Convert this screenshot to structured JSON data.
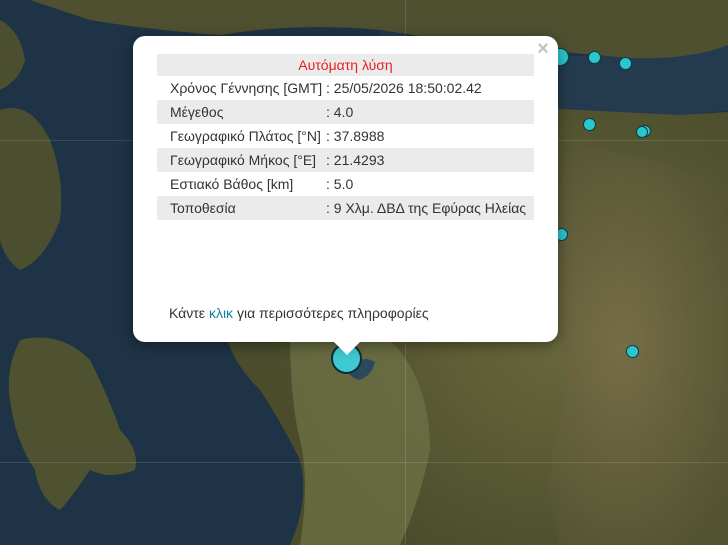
{
  "map": {
    "water_color": "#1e3345",
    "land_color": "#5a5a34",
    "marker_color": "#2cc6d1"
  },
  "popup": {
    "title": "Αυτόματη λύση",
    "title_color": "#e8201e",
    "close_symbol": "×",
    "rows": [
      {
        "label": "Χρόνος Γέννησης [GMT]",
        "value": ": 25/05/2026 18:50:02.42"
      },
      {
        "label": "Μέγεθος",
        "value": ": 4.0"
      },
      {
        "label": "Γεωγραφικό Πλάτος [°N]",
        "value": ": 37.8988"
      },
      {
        "label": "Γεωγραφικό Μήκος [°E]",
        "value": ": 21.4293"
      },
      {
        "label": "Εστιακό Βάθος [km]",
        "value": ": 5.0"
      },
      {
        "label": "Τοποθεσία",
        "value": ": 9 Χλμ. ΔΒΔ της Εφύρας Ηλείας"
      }
    ],
    "footer_prefix": "Κάντε",
    "footer_link": "κλικ",
    "footer_suffix": "για περισσότερες πληροφορίες"
  }
}
